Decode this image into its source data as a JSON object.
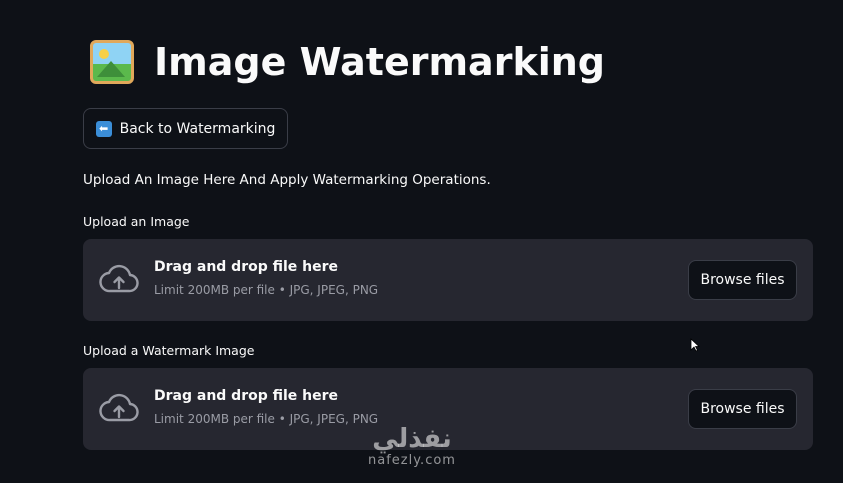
{
  "header": {
    "title": "Image Watermarking",
    "title_icon": "framed-picture-icon"
  },
  "back_button": {
    "label": "Back to Watermarking",
    "icon": "left-arrow-icon",
    "icon_glyph": "⬅"
  },
  "intro_text": "Upload An Image Here And Apply Watermarking Operations.",
  "uploaders": [
    {
      "label": "Upload an Image",
      "drop_title": "Drag and drop file here",
      "limit": "Limit 200MB per file • JPG, JPEG, PNG",
      "browse_label": "Browse files"
    },
    {
      "label": "Upload a Watermark Image",
      "drop_title": "Drag and drop file here",
      "limit": "Limit 200MB per file • JPG, JPEG, PNG",
      "browse_label": "Browse files"
    }
  ],
  "overlay_watermark": {
    "arabic": "نفذلي",
    "latin": "nafezly.com"
  },
  "colors": {
    "background": "#0e1117",
    "dropzone": "#262730",
    "text": "#fafafa",
    "muted": "#9a9ca5"
  }
}
